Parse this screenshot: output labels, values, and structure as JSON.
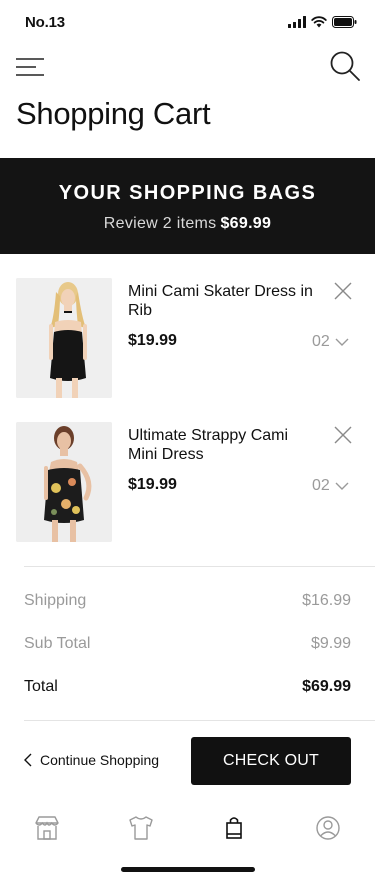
{
  "status_bar": {
    "carrier": "No.13"
  },
  "header": {
    "title": "Shopping Cart"
  },
  "bag": {
    "title": "YOUR SHOPPING BAGS",
    "review_text": "Review 2 items",
    "total": "$69.99"
  },
  "cart": {
    "items": [
      {
        "name": "Mini Cami Skater Dress in Rib",
        "price": "$19.99",
        "quantity": "02"
      },
      {
        "name": "Ultimate Strappy Cami Mini Dress",
        "price": "$19.99",
        "quantity": "02"
      }
    ]
  },
  "summary": {
    "shipping_label": "Shipping",
    "shipping_value": "$16.99",
    "subtotal_label": "Sub Total",
    "subtotal_value": "$9.99",
    "total_label": "Total",
    "total_value": "$69.99"
  },
  "actions": {
    "continue_label": "Continue Shopping",
    "checkout_label": "CHECK OUT"
  },
  "tab_bar": {
    "tabs": [
      "store-icon",
      "shirt-icon",
      "bag-icon",
      "profile-icon"
    ],
    "active": "bag-icon"
  },
  "colors": {
    "banner_bg": "#141414",
    "button_bg": "#111111",
    "muted_text": "#9a9a9a"
  }
}
